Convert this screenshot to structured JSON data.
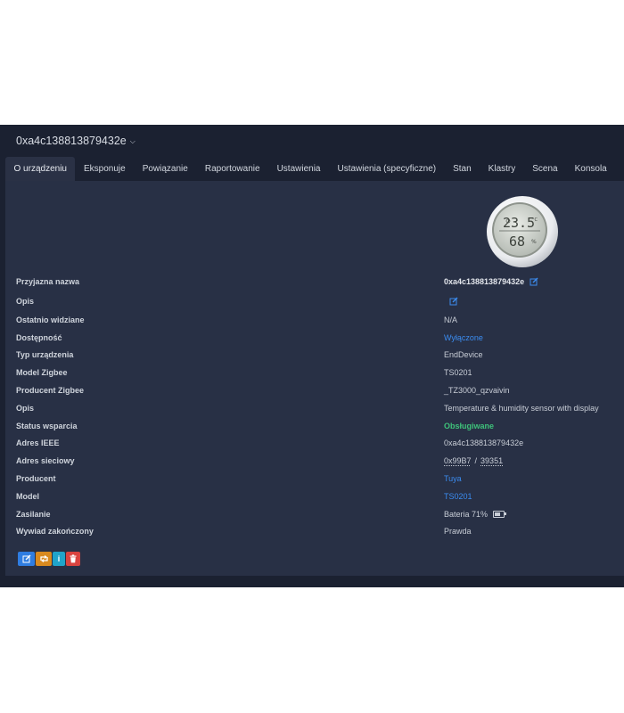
{
  "header": {
    "device_name": "0xa4c138813879432e"
  },
  "tabs": [
    {
      "label": "O urządzeniu",
      "active": true
    },
    {
      "label": "Eksponuje"
    },
    {
      "label": "Powiązanie"
    },
    {
      "label": "Raportowanie"
    },
    {
      "label": "Ustawienia"
    },
    {
      "label": "Ustawienia (specyficzne)"
    },
    {
      "label": "Stan"
    },
    {
      "label": "Klastry"
    },
    {
      "label": "Scena"
    },
    {
      "label": "Konsola"
    }
  ],
  "device_image": {
    "display_temp": "23.5",
    "display_hum": "68"
  },
  "rows": {
    "friendly_name": {
      "label": "Przyjazna nazwa",
      "value": "0xa4c138813879432e"
    },
    "description": {
      "label": "Opis"
    },
    "last_seen": {
      "label": "Ostatnio widziane",
      "value": "N/A"
    },
    "availability": {
      "label": "Dostępność",
      "value": "Wyłączone"
    },
    "device_type": {
      "label": "Typ urządzenia",
      "value": "EndDevice"
    },
    "zigbee_model": {
      "label": "Model Zigbee",
      "value": "TS0201"
    },
    "zigbee_manufacturer": {
      "label": "Producent Zigbee",
      "value": "_TZ3000_qzvaivin"
    },
    "model_description": {
      "label": "Opis",
      "value": "Temperature & humidity sensor with display"
    },
    "support_status": {
      "label": "Status wsparcia",
      "value": "Obsługiwane"
    },
    "ieee_address": {
      "label": "Adres IEEE",
      "value": "0xa4c138813879432e"
    },
    "network_address": {
      "label": "Adres sieciowy",
      "hex": "0x99B7",
      "separator": "/",
      "dec": "39351"
    },
    "manufacturer": {
      "label": "Producent",
      "value": "Tuya"
    },
    "model": {
      "label": "Model",
      "value": "TS0201"
    },
    "power": {
      "label": "Zasilanie",
      "value": "Bateria 71%",
      "battery_level": 0.71
    },
    "interview": {
      "label": "Wywiad zakończony",
      "value": "Prawda"
    }
  },
  "actions": {
    "info_label": "i"
  },
  "colors": {
    "background": "#1b2131",
    "panel": "#283045",
    "link": "#3b8cf0",
    "supported": "#3ec27a",
    "btn_edit": "#2f7de1",
    "btn_reconfigure": "#d98a1f",
    "btn_info": "#20a4c9",
    "btn_delete": "#d9433f"
  }
}
